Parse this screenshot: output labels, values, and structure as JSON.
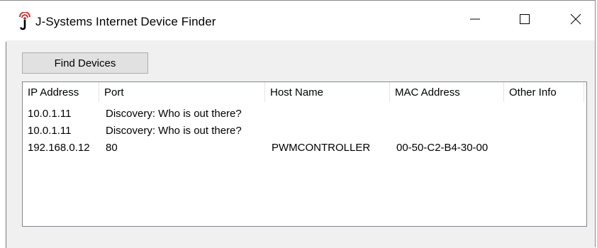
{
  "window": {
    "title": "J-Systems Internet Device Finder",
    "icon": "jsystems-antenna-logo-icon"
  },
  "controls": {
    "minimize": "minimize-icon",
    "maximize": "maximize-icon",
    "close": "close-icon"
  },
  "toolbar": {
    "find_label": "Find Devices"
  },
  "table": {
    "columns": [
      "IP Address",
      "Port",
      "Host Name",
      "MAC Address",
      "Other Info"
    ],
    "rows": [
      [
        "10.0.1.11",
        "Discovery: Who is out there?",
        "",
        "",
        ""
      ],
      [
        "10.0.1.11",
        "Discovery: Who is out there?",
        "",
        "",
        ""
      ],
      [
        "192.168.0.12",
        "80",
        "PWMCONTROLLER",
        "00-50-C2-B4-30-00",
        ""
      ]
    ]
  },
  "colors": {
    "client_bg": "#f0f0f0",
    "button_bg": "#e1e1e1",
    "icon_red": "#d42020"
  }
}
